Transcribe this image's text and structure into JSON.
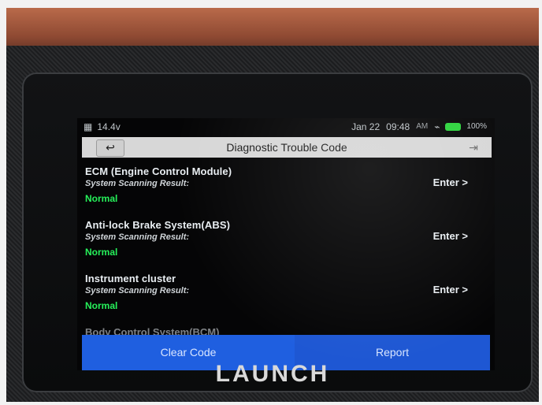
{
  "device": {
    "brand": "LAUNCH"
  },
  "status_bar": {
    "left_icon": "calendar-icon",
    "voltage": "14.4v",
    "date": "Jan 22",
    "time": "09:48",
    "time_suffix": "AM",
    "wifi_icon": "wifi-icon",
    "battery_percent": "100%"
  },
  "titlebar": {
    "back_icon": "back-arrow-icon",
    "title": "Diagnostic Trouble Code",
    "exit_icon": "exit-icon"
  },
  "systems": [
    {
      "name": "ECM (Engine Control Module)",
      "result_label": "System Scanning Result:",
      "status": "Normal",
      "enter_label": "Enter >"
    },
    {
      "name": "Anti-lock Brake System(ABS)",
      "result_label": "System Scanning Result:",
      "status": "Normal",
      "enter_label": "Enter >"
    },
    {
      "name": "Instrument cluster",
      "result_label": "System Scanning Result:",
      "status": "Normal",
      "enter_label": "Enter >"
    }
  ],
  "partial_item": {
    "name": "Body Control System(BCM)"
  },
  "footer": {
    "clear_code": "Clear Code",
    "report": "Report"
  },
  "colors": {
    "normal_status": "#26F05A",
    "button_blue": "#1F5FE0",
    "battery_green": "#2BD43B"
  }
}
